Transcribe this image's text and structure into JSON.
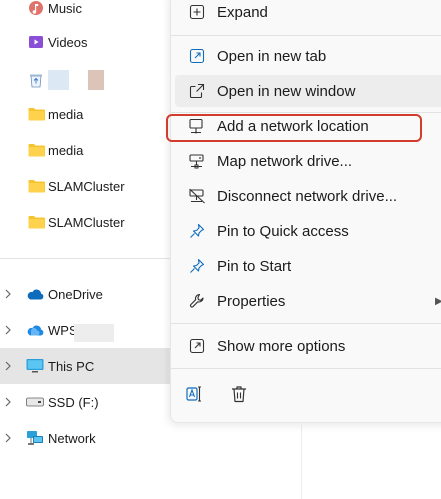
{
  "nav": {
    "items": [
      {
        "label": "Music",
        "icon": "music-icon",
        "color": "#e0736b"
      },
      {
        "label": "Videos",
        "icon": "videos-icon",
        "color": "#8a4fd6"
      },
      {
        "label": "",
        "icon": "recycle-bin-icon",
        "color": "#3a7bd5"
      },
      {
        "label": "media",
        "icon": "folder-icon",
        "color": "#f4c430"
      },
      {
        "label": "media",
        "icon": "folder-icon",
        "color": "#f4c430"
      },
      {
        "label": "SLAMCluster",
        "icon": "folder-icon",
        "color": "#f4c430"
      },
      {
        "label": "SLAMCluster",
        "icon": "folder-icon",
        "color": "#f4c430"
      },
      {
        "label": "OneDrive",
        "icon": "onedrive-cloud-icon",
        "color": "#0f6cbd"
      },
      {
        "label": "WPS",
        "icon": "wps-cloud-icon",
        "color": "#1e88e5"
      },
      {
        "label": "This PC",
        "icon": "this-pc-icon",
        "color": "#2b9fd8"
      },
      {
        "label": "SSD (F:)",
        "icon": "drive-icon",
        "color": "#555555"
      },
      {
        "label": "Network",
        "icon": "network-icon",
        "color": "#2b9fd8"
      }
    ]
  },
  "menu": {
    "items": [
      {
        "label": "Expand",
        "icon": "expand-icon"
      },
      {
        "label": "Open in new tab",
        "icon": "open-new-tab-icon"
      },
      {
        "label": "Open in new window",
        "icon": "open-new-window-icon"
      },
      {
        "label": "Add a network location",
        "icon": "add-network-location-icon"
      },
      {
        "label": "Map network drive...",
        "icon": "map-network-drive-icon"
      },
      {
        "label": "Disconnect network drive...",
        "icon": "disconnect-network-drive-icon"
      },
      {
        "label": "Pin to Quick access",
        "icon": "pin-icon"
      },
      {
        "label": "Pin to Start",
        "icon": "pin-icon"
      },
      {
        "label": "Properties",
        "icon": "wrench-icon"
      },
      {
        "label": "Show more options",
        "icon": "show-more-options-icon"
      }
    ],
    "highlight_color": "#d13c2b",
    "accent": "#0f6cbd"
  }
}
